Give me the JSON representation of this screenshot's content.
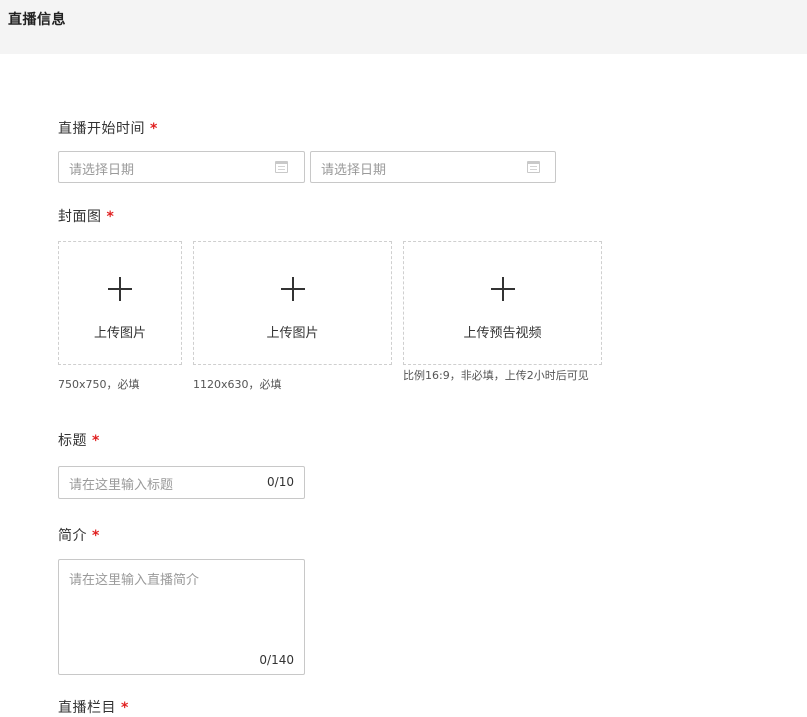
{
  "section": {
    "title": "直播信息"
  },
  "start_time": {
    "label": "直播开始时间",
    "required_mark": "*",
    "start_placeholder": "请选择日期",
    "end_placeholder": "请选择日期",
    "icon": "calendar-icon"
  },
  "cover": {
    "label": "封面图",
    "required_mark": "*",
    "uploads": [
      {
        "label": "上传图片",
        "hint": "750x750，必填",
        "icon": "plus-icon"
      },
      {
        "label": "上传图片",
        "hint": "1120x630，必填",
        "icon": "plus-icon"
      },
      {
        "label": "上传预告视频",
        "hint": "比例16:9，非必填，上传2小时后可见",
        "icon": "plus-icon"
      }
    ]
  },
  "title_field": {
    "label": "标题",
    "required_mark": "*",
    "placeholder": "请在这里输入标题",
    "counter": "0/10"
  },
  "intro_field": {
    "label": "简介",
    "required_mark": "*",
    "placeholder": "请在这里输入直播简介",
    "counter": "0/140"
  },
  "column_field": {
    "label": "直播栏目",
    "required_mark": "*"
  },
  "colors": {
    "required": "#e02020",
    "border": "#c8c8c8",
    "placeholder": "#9a9a9a",
    "header_bg": "#f4f4f4"
  }
}
